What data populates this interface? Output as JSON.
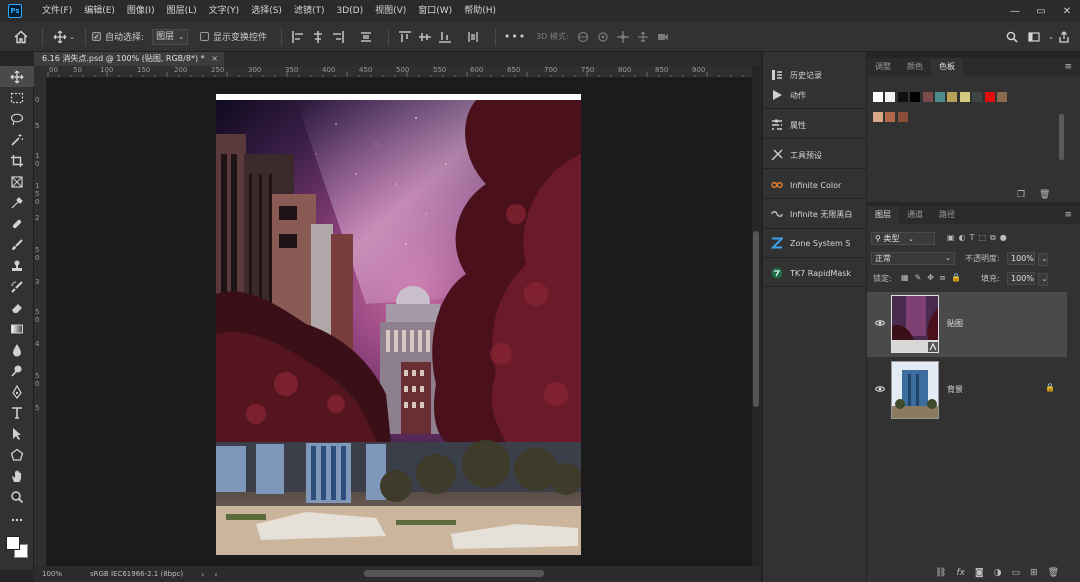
{
  "app": {
    "logo": "Ps"
  },
  "menu": [
    "文件(F)",
    "编辑(E)",
    "图像(I)",
    "图层(L)",
    "文字(Y)",
    "选择(S)",
    "滤镜(T)",
    "3D(D)",
    "视图(V)",
    "窗口(W)",
    "帮助(H)"
  ],
  "window_controls": {
    "minimize": "—",
    "restore": "▭",
    "close": "✕"
  },
  "options_bar": {
    "auto_select_label": "自动选择:",
    "auto_select_checked": true,
    "auto_select_value": "图层",
    "show_transform_label": "显示变换控件",
    "more": "•••",
    "mode_3d_label": "3D 模式:"
  },
  "document": {
    "tab_title": "6.16 消失点.psd @ 100% (贴图, RGB/8*) *",
    "tab_close": "×",
    "zoom": "100%",
    "color_profile": "sRGB IEC61966-2.1 (8bpc)"
  },
  "ruler": {
    "top_labels": [
      "00",
      "50",
      "100",
      "150",
      "200",
      "250",
      "300",
      "350",
      "400",
      "450",
      "500",
      "550",
      "600",
      "650",
      "700",
      "750",
      "800",
      "850",
      "900"
    ],
    "left_labels": [
      "0",
      "5",
      "1",
      "0",
      "1",
      "5",
      "0",
      "2",
      "5",
      "0",
      "3",
      "5",
      "0",
      "4",
      "5",
      "0",
      "5"
    ]
  },
  "dock": {
    "items": [
      {
        "label": "历史记录",
        "icon": "history-icon"
      },
      {
        "label": "动作",
        "icon": "play-icon"
      },
      {
        "label": "属性",
        "icon": "properties-icon"
      },
      {
        "label": "工具预设",
        "icon": "tool-presets-icon"
      },
      {
        "label": "Infinite Color",
        "icon": "infinite-color-icon"
      },
      {
        "label": "Infinite 无限黑白",
        "icon": "infinite-bw-icon"
      },
      {
        "label": "Zone System S",
        "icon": "zone-system-icon"
      },
      {
        "label": "TK7 RapidMask",
        "icon": "tk7-icon"
      }
    ]
  },
  "swatches_panel": {
    "tabs": [
      "调整",
      "颜色",
      "色板"
    ],
    "active_tab": "色板",
    "colors_row1": [
      "#ffffff",
      "#f2f2f2",
      "#111111",
      "#000000",
      "#7a4a4a",
      "#4f8a8f",
      "#b7a15a",
      "#d4c97c",
      "#3f4447",
      "#e00d0d",
      "#8a6a4c"
    ],
    "colors_row2": [
      "#d9a987",
      "#b06a4a",
      "#8a4e36"
    ]
  },
  "layers_panel": {
    "tabs": [
      "图层",
      "通道",
      "路径"
    ],
    "active_tab": "图层",
    "filter_label": "类型",
    "blend_mode": "正常",
    "opacity_label": "不透明度:",
    "opacity_value": "100%",
    "lock_label": "锁定:",
    "fill_label": "填充:",
    "fill_value": "100%",
    "layers": [
      {
        "name": "贴图",
        "selected": true,
        "visible": true,
        "locked": false
      },
      {
        "name": "背景",
        "selected": false,
        "visible": true,
        "locked": true
      }
    ],
    "footer_icons": [
      "link-icon",
      "fx-icon",
      "mask-icon",
      "adjustment-icon",
      "group-icon",
      "new-layer-icon",
      "trash-icon"
    ],
    "footer_fx": "fx"
  }
}
